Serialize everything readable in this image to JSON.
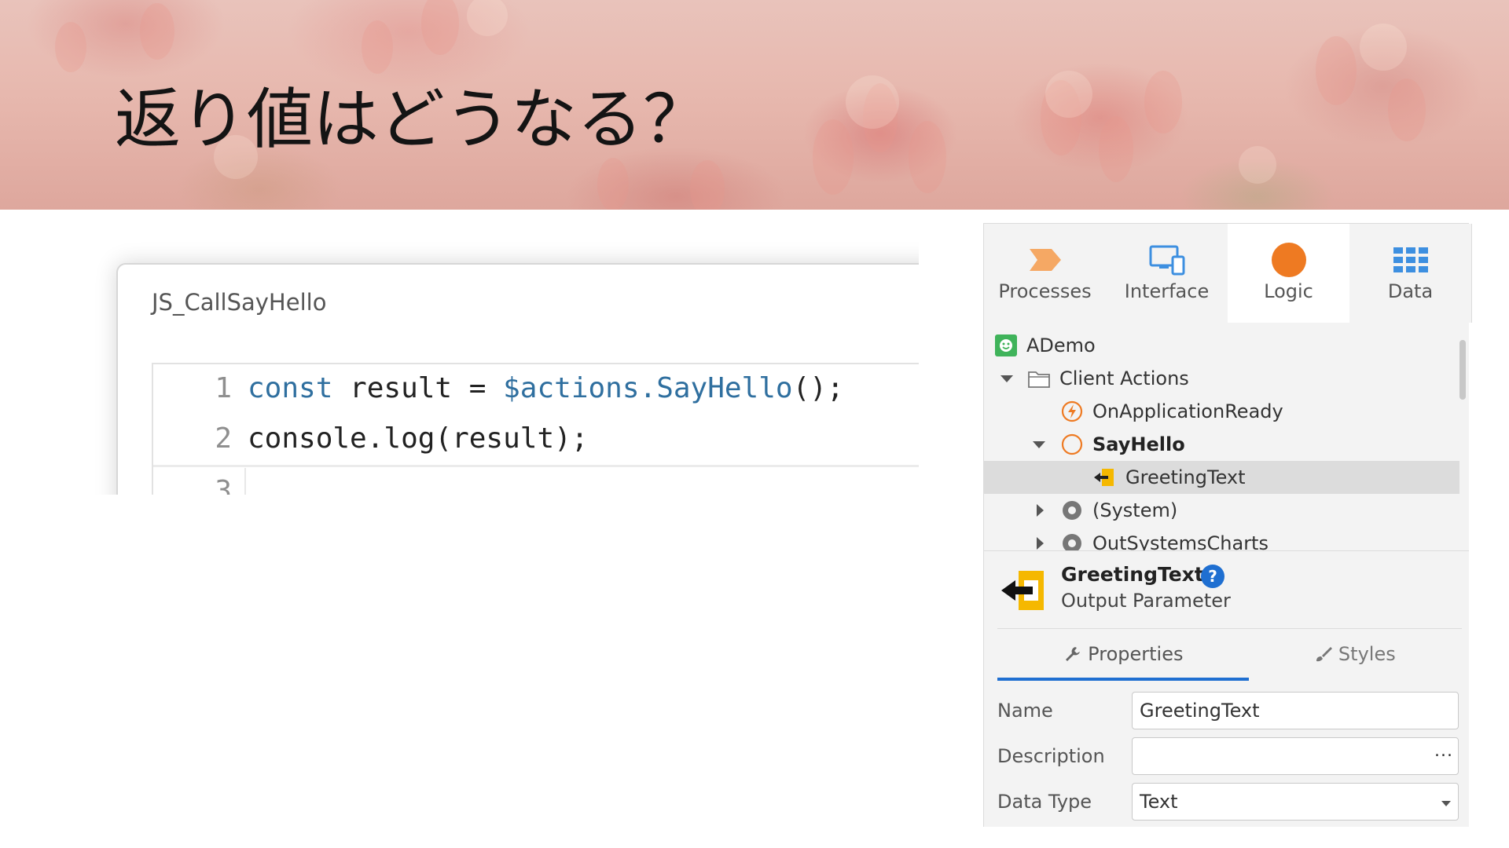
{
  "slide": {
    "title": "返り値はどうなる？"
  },
  "code_card": {
    "title": "JS_CallSayHello",
    "lines": [
      {
        "num": "1",
        "parts": [
          "const",
          " result = ",
          "$actions.SayHello",
          "();"
        ]
      },
      {
        "num": "2",
        "text": "console.log(result);"
      },
      {
        "num": "3",
        "text": ""
      }
    ]
  },
  "panel": {
    "tabs": [
      {
        "label": "Processes",
        "icon": "processes-icon"
      },
      {
        "label": "Interface",
        "icon": "interface-icon"
      },
      {
        "label": "Logic",
        "icon": "logic-icon",
        "active": true
      },
      {
        "label": "Data",
        "icon": "data-icon"
      }
    ],
    "tree": {
      "items": [
        {
          "label": "ADemo",
          "icon": "app-icon"
        },
        {
          "label": "Client Actions",
          "icon": "folder-icon",
          "expanded": true
        },
        {
          "label": "OnApplicationReady",
          "icon": "event-action-icon"
        },
        {
          "label": "SayHello",
          "icon": "action-icon",
          "expanded": true
        },
        {
          "label": "GreetingText",
          "icon": "output-parameter-icon",
          "selected": true
        },
        {
          "label": "(System)",
          "icon": "module-ref-icon",
          "expanded": false
        },
        {
          "label": "OutSystemsCharts",
          "icon": "module-ref-icon",
          "expanded": false
        }
      ]
    },
    "detail": {
      "name": "GreetingText",
      "type": "Output Parameter",
      "help": "?"
    },
    "subtabs": {
      "properties": "Properties",
      "styles": "Styles"
    },
    "properties": {
      "name_label": "Name",
      "name_value": "GreetingText",
      "description_label": "Description",
      "description_value": "",
      "description_more": "...",
      "data_type_label": "Data Type",
      "data_type_value": "Text"
    },
    "colors": {
      "accent": "#1f6fd1",
      "logic": "#ee7a22",
      "processes": "#f5a864",
      "interface": "#3d8fe0",
      "app": "#3fb35a",
      "selected_row": "#dcdcdc"
    }
  }
}
